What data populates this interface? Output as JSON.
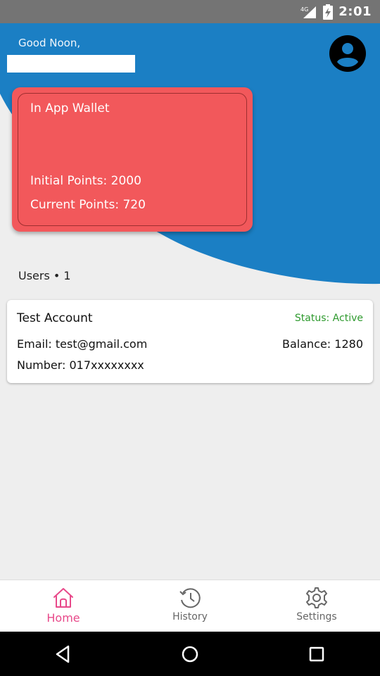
{
  "status_bar": {
    "time": "2:01",
    "network": "4G",
    "icons": [
      "signal-icon",
      "battery-charging-icon"
    ]
  },
  "header": {
    "greeting": "Good Noon,",
    "name": "",
    "avatar_icon": "account-circle-icon",
    "background_color": "#1b7fc4"
  },
  "wallet": {
    "title": "In App Wallet",
    "initial_points_text": "Initial Points: 2000",
    "current_points_text": "Current Points: 720",
    "color": "#f2585b"
  },
  "users": {
    "label": "Users • 1",
    "items": [
      {
        "name": "Test Account",
        "status": "Status: Active",
        "email": "Email: test@gmail.com",
        "balance": "Balance: 1280",
        "number": "Number: 017xxxxxxxx"
      }
    ]
  },
  "bottom_nav": {
    "items": [
      {
        "label": "Home",
        "icon": "home-icon",
        "active": true
      },
      {
        "label": "History",
        "icon": "history-icon",
        "active": false
      },
      {
        "label": "Settings",
        "icon": "settings-icon",
        "active": false
      }
    ],
    "active_color": "#e8498a"
  },
  "system_nav": {
    "icons": [
      "back-icon",
      "home-circle-icon",
      "recents-icon"
    ]
  }
}
